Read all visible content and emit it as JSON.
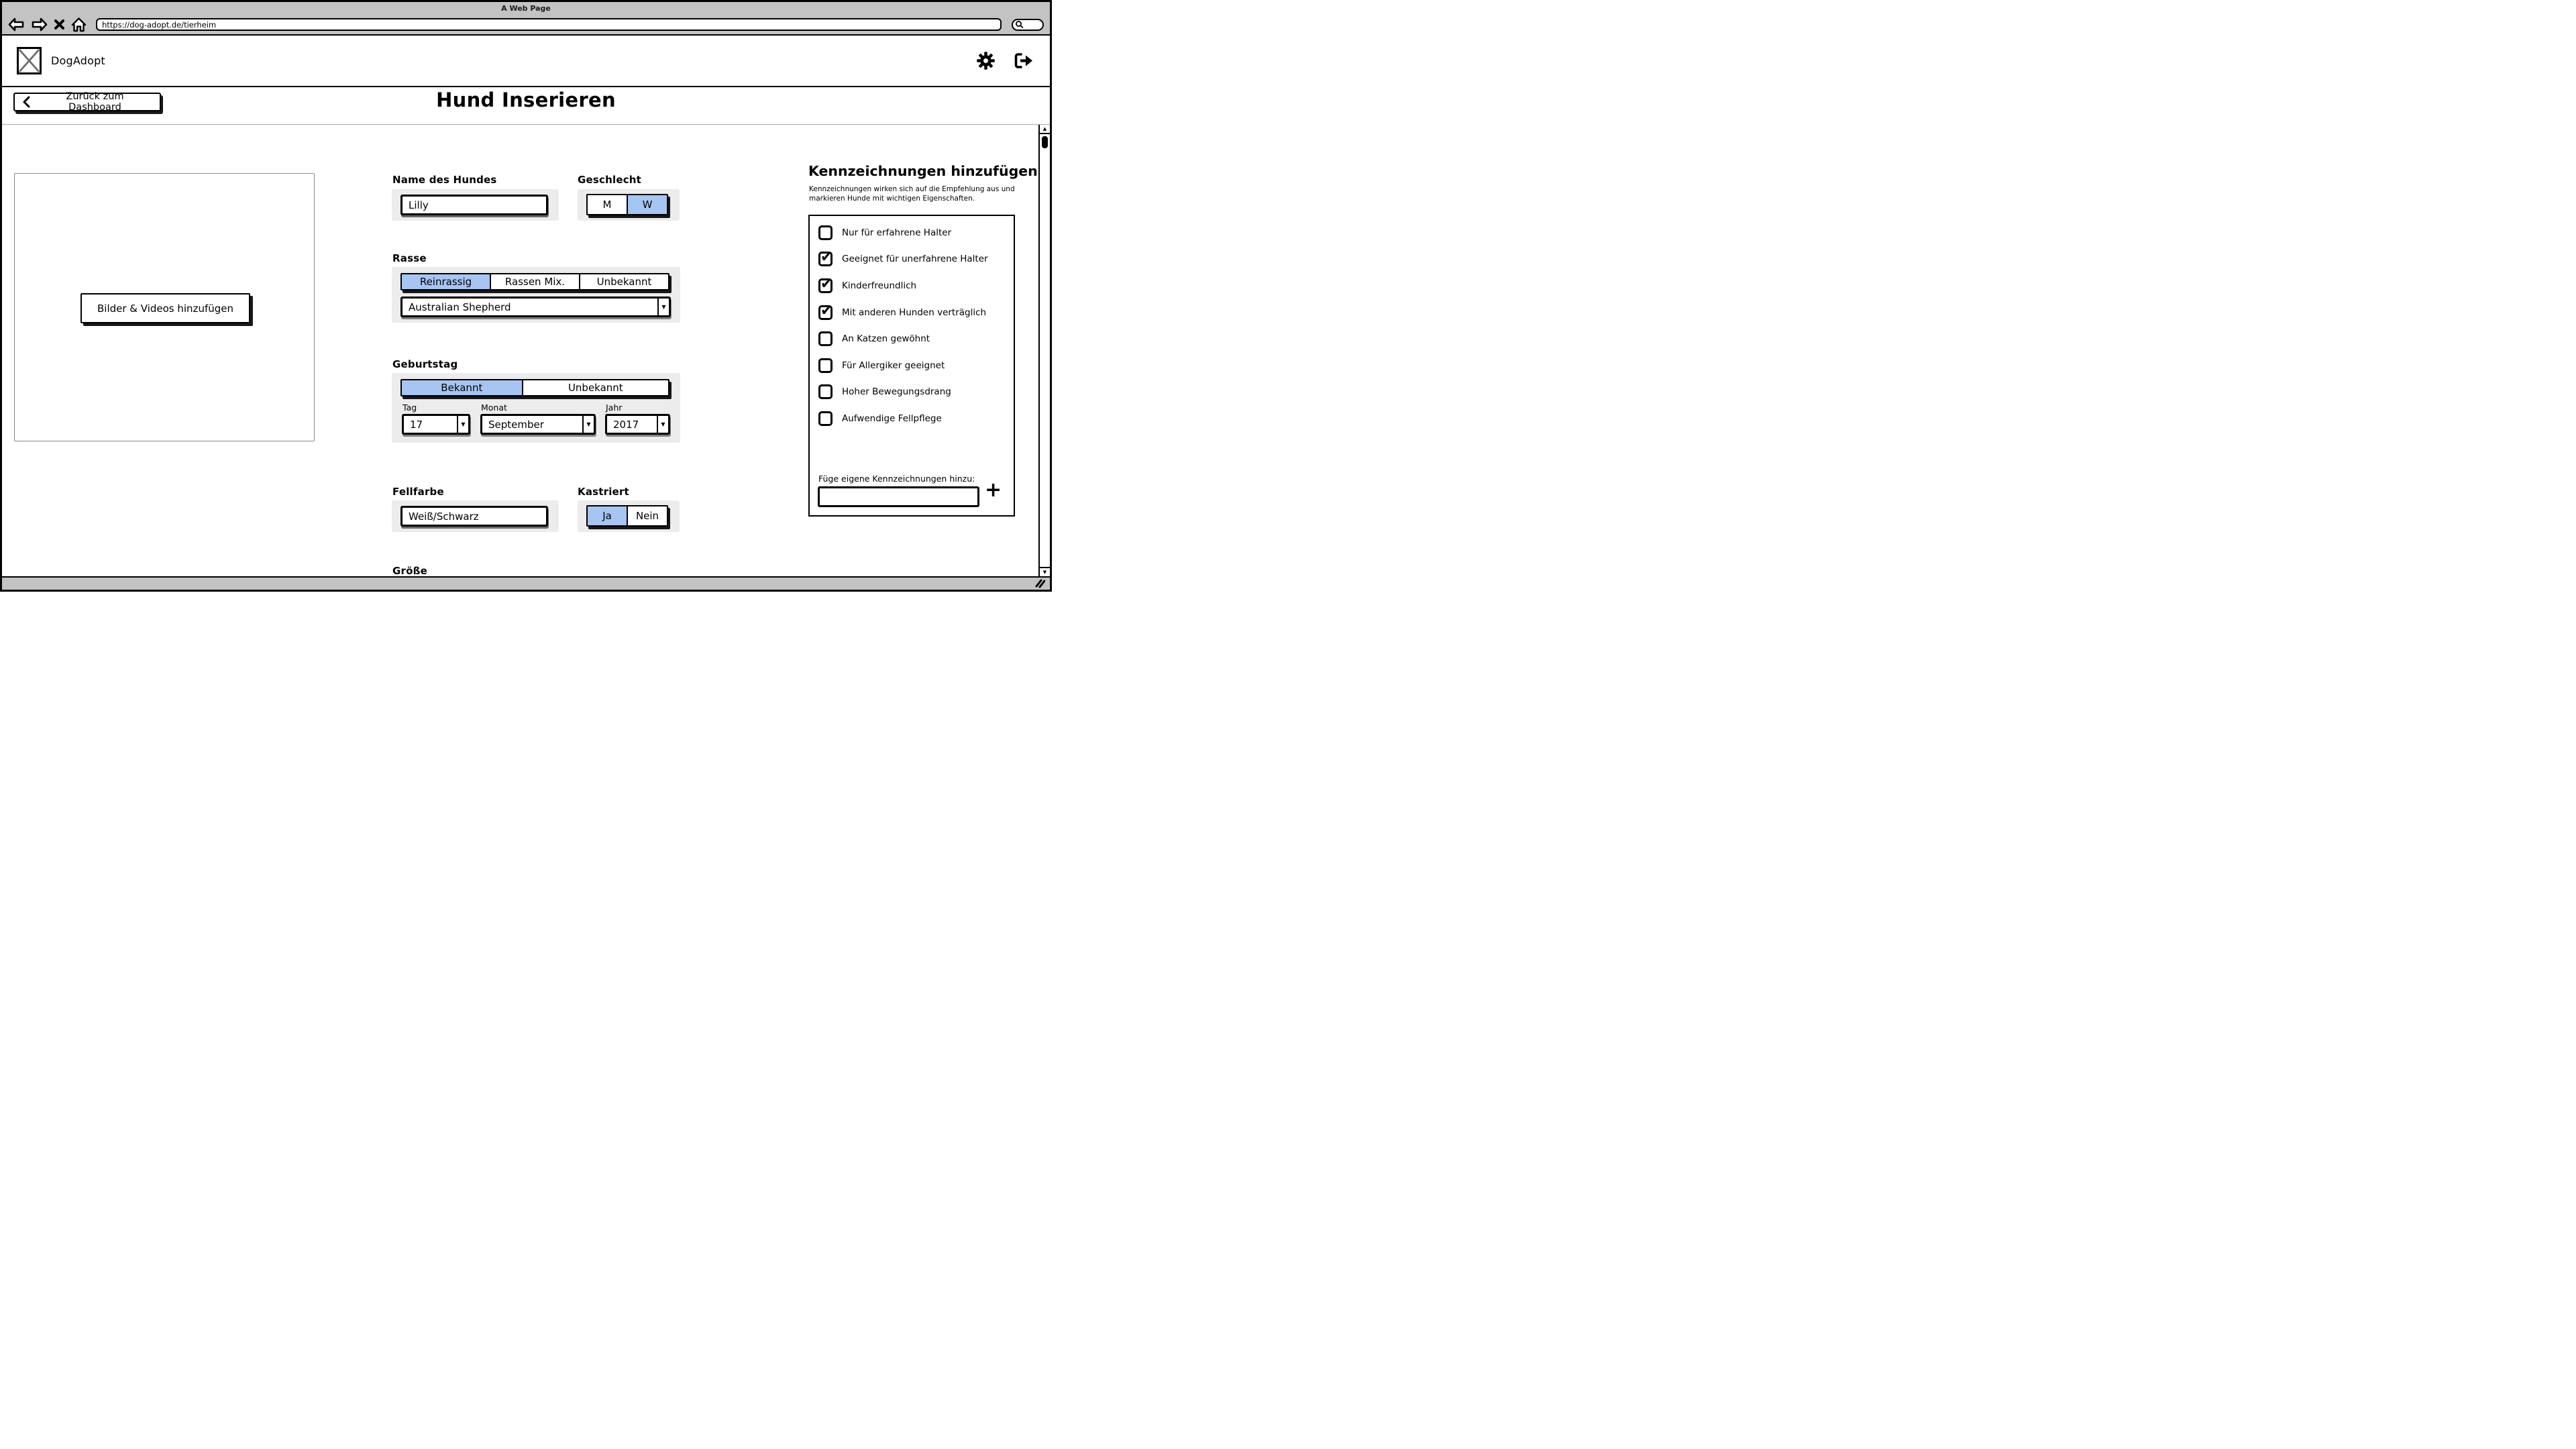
{
  "browser": {
    "window_title": "A Web Page",
    "url": "https://dog-adopt.de/tierheim"
  },
  "header": {
    "brand": "DogAdopt"
  },
  "nav": {
    "back_button": "Zurück zum Dashboard"
  },
  "page": {
    "title": "Hund Inserieren"
  },
  "media": {
    "add_button": "Bilder & Videos hinzufügen"
  },
  "form": {
    "name": {
      "label": "Name des Hundes",
      "value": "Lilly"
    },
    "gender": {
      "label": "Geschlecht",
      "toggle": {
        "options": [
          "M",
          "W"
        ],
        "selected": "W"
      }
    },
    "breed": {
      "label": "Rasse",
      "type": {
        "options": [
          "Reinrassig",
          "Rassen Mix.",
          "Unbekannt"
        ],
        "selected": "Reinrassig"
      },
      "value": "Australian Shepherd"
    },
    "birthday": {
      "label": "Geburtstag",
      "known": {
        "options": [
          "Bekannt",
          "Unbekannt"
        ],
        "selected": "Bekannt"
      },
      "day": {
        "label": "Tag",
        "value": "17"
      },
      "month": {
        "label": "Monat",
        "value": "September"
      },
      "year": {
        "label": "Jahr",
        "value": "2017"
      }
    },
    "fur": {
      "label": "Fellfarbe",
      "value": "Weiß/Schwarz"
    },
    "neutered": {
      "label": "Kastriert",
      "toggle": {
        "options": [
          "Ja",
          "Nein"
        ],
        "selected": "Ja"
      }
    },
    "size": {
      "label": "Größe"
    }
  },
  "tags_panel": {
    "title": "Kennzeichnungen hinzufügen",
    "subtitle": "Kennzeichnungen wirken sich auf die Empfehlung aus und markieren Hunde mit wichtigen Eigenschaften.",
    "items": [
      {
        "label": "Nur für erfahrene Halter",
        "checked": false
      },
      {
        "label": "Geeignet für unerfahrene Halter",
        "checked": true
      },
      {
        "label": "Kinderfreundlich",
        "checked": true
      },
      {
        "label": "Mit anderen Hunden verträglich",
        "checked": true
      },
      {
        "label": "An Katzen gewöhnt",
        "checked": false
      },
      {
        "label": "Für Allergiker geeignet",
        "checked": false
      },
      {
        "label": "Hoher Bewegungsdrang",
        "checked": false
      },
      {
        "label": "Aufwendige Fellpflege",
        "checked": false
      }
    ],
    "custom_label": "Füge eigene Kennzeichnungen hinzu:",
    "add_icon": "+"
  },
  "icons": {
    "up_arrow": "▲",
    "down_arrow": "▼",
    "check": "✔"
  },
  "colors": {
    "accent_blue": "#a7c5f2",
    "chrome_gray": "#c3c3c3",
    "panel_gray": "#ececec"
  }
}
